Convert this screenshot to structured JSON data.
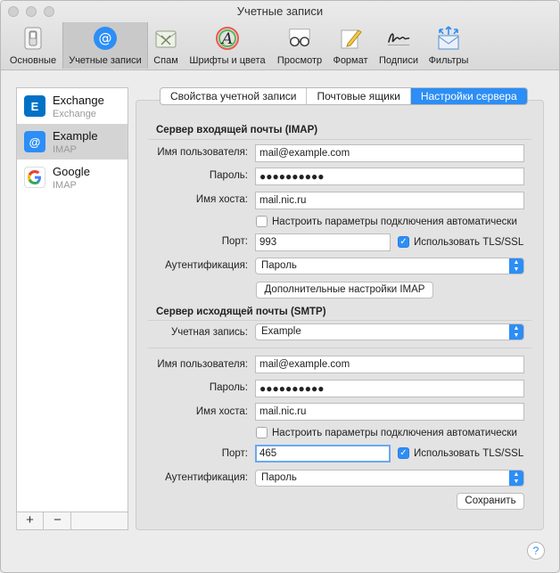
{
  "window": {
    "title": "Учетные записи"
  },
  "toolbar": {
    "items": [
      {
        "label": "Основные",
        "icon": "switch-icon"
      },
      {
        "label": "Учетные записи",
        "icon": "at-sign-icon"
      },
      {
        "label": "Спам",
        "icon": "junk-mail-icon"
      },
      {
        "label": "Шрифты и цвета",
        "icon": "font-icon"
      },
      {
        "label": "Просмотр",
        "icon": "glasses-icon"
      },
      {
        "label": "Формат",
        "icon": "pencil-icon"
      },
      {
        "label": "Подписи",
        "icon": "signature-icon"
      },
      {
        "label": "Фильтры",
        "icon": "filters-icon"
      }
    ],
    "active_index": 1
  },
  "accounts": [
    {
      "name": "Exchange",
      "type": "Exchange",
      "icon": "exchange-icon",
      "color": "#0072c6"
    },
    {
      "name": "Example",
      "type": "IMAP",
      "icon": "at-sign-icon",
      "color": "#2c8ef6"
    },
    {
      "name": "Google",
      "type": "IMAP",
      "icon": "google-icon",
      "color": "#ea4335"
    }
  ],
  "sidebar_footer": {
    "add": "+",
    "remove": "−"
  },
  "tabs": [
    {
      "label": "Свойства учетной записи",
      "active": false
    },
    {
      "label": "Почтовые ящики",
      "active": false
    },
    {
      "label": "Настройки сервера",
      "active": true
    }
  ],
  "imap": {
    "title": "Сервер входящей почты (IMAP)",
    "username_label": "Имя пользователя:",
    "username": "mail@example.com",
    "password_label": "Пароль:",
    "password": "●●●●●●●●●●",
    "host_label": "Имя хоста:",
    "host": "mail.nic.ru",
    "auto_label": "Настроить параметры подключения автоматически",
    "auto_checked": false,
    "port_label": "Порт:",
    "port": "993",
    "tls_label": "Использовать TLS/SSL",
    "tls_checked": true,
    "auth_label": "Аутентификация:",
    "auth": "Пароль",
    "advanced_button": "Дополнительные настройки IMAP"
  },
  "smtp": {
    "title": "Сервер исходящей почты (SMTP)",
    "account_label": "Учетная запись:",
    "account": "Example",
    "username_label": "Имя пользователя:",
    "username": "mail@example.com",
    "password_label": "Пароль:",
    "password": "●●●●●●●●●●",
    "host_label": "Имя хоста:",
    "host": "mail.nic.ru",
    "auto_label": "Настроить параметры подключения автоматически",
    "auto_checked": false,
    "port_label": "Порт:",
    "port": "465",
    "tls_label": "Использовать TLS/SSL",
    "tls_checked": true,
    "auth_label": "Аутентификация:",
    "auth": "Пароль",
    "save_button": "Сохранить"
  },
  "help": "?"
}
